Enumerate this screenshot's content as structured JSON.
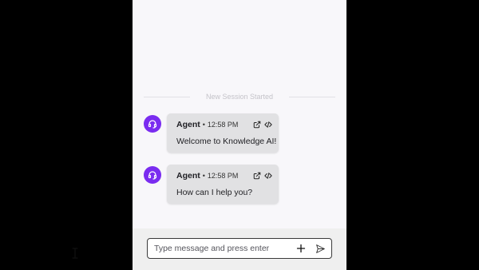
{
  "session": {
    "divider_text": "New Session Started"
  },
  "messages": [
    {
      "sender": "Agent",
      "separator": "•",
      "time": "12:58 PM",
      "text": "Welcome to Knowledge AI!"
    },
    {
      "sender": "Agent",
      "separator": "•",
      "time": "12:58 PM",
      "text": "How can I help you?"
    }
  ],
  "composer": {
    "placeholder": "Type message and press enter",
    "value": ""
  },
  "icons": {
    "avatar": "headset-icon",
    "open": "external-link-icon",
    "embed": "code-icon",
    "add": "plus-icon",
    "send": "send-icon"
  },
  "colors": {
    "accent": "#7a2cf0",
    "bubble": "#e1e1e3",
    "panel_background": "#f8f7fa",
    "outside_background": "#000000"
  }
}
